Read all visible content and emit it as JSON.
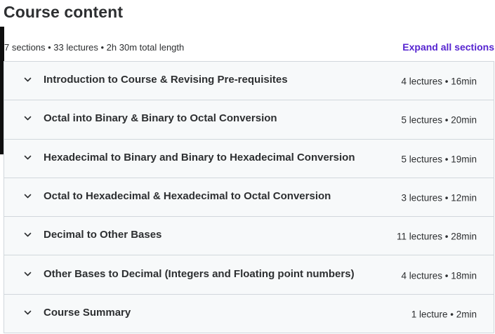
{
  "header": {
    "title": "Course content"
  },
  "summary": {
    "text": "7 sections • 33 lectures • 2h 30m total length",
    "expand_label": "Expand all sections"
  },
  "colors": {
    "link": "#5624d0",
    "section_bg": "#f7f9fa",
    "border": "#d1d7dc",
    "text": "#2d2f31"
  },
  "sections": [
    {
      "title": "Introduction to Course & Revising Pre-requisites",
      "meta": "4 lectures • 16min",
      "icon": "chevron-down-icon"
    },
    {
      "title": "Octal into Binary & Binary to Octal Conversion",
      "meta": "5 lectures • 20min",
      "icon": "chevron-down-icon"
    },
    {
      "title": "Hexadecimal to Binary and Binary to Hexadecimal Conversion",
      "meta": "5 lectures • 19min",
      "icon": "chevron-down-icon"
    },
    {
      "title": "Octal to Hexadecimal & Hexadecimal to Octal Conversion",
      "meta": "3 lectures • 12min",
      "icon": "chevron-down-icon"
    },
    {
      "title": "Decimal to Other Bases",
      "meta": "11 lectures • 28min",
      "icon": "chevron-down-icon"
    },
    {
      "title": "Other Bases to Decimal (Integers and Floating point numbers)",
      "meta": "4 lectures • 18min",
      "icon": "chevron-down-icon"
    },
    {
      "title": "Course Summary",
      "meta": "1 lecture • 2min",
      "icon": "chevron-down-icon"
    }
  ]
}
